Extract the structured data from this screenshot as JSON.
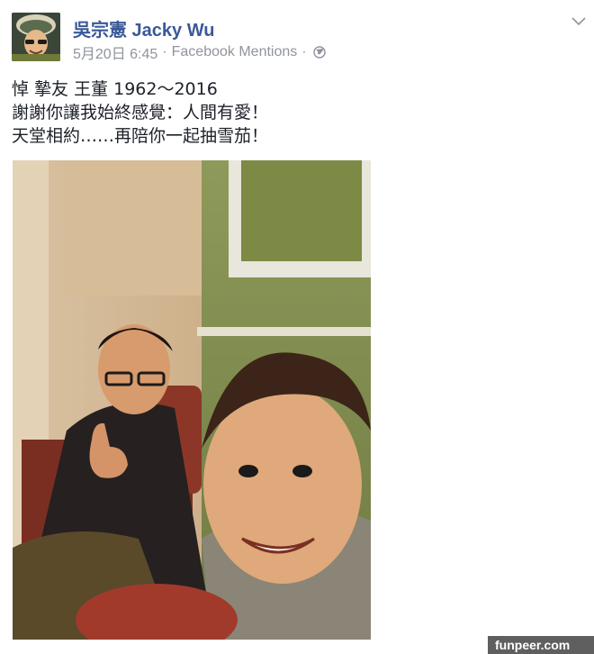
{
  "post": {
    "author_name": "吳宗憲 Jacky Wu",
    "date": "5月20日 6:45",
    "separator": "·",
    "source": "Facebook Mentions",
    "privacy_icon": "globe-icon",
    "menu_icon": "chevron-down-icon",
    "text_lines": [
      "悼 摯友 王董 1962～2016",
      "謝謝你讓我始終感覺：人間有愛！",
      "天堂相約……再陪你一起抽雪茄！"
    ]
  },
  "colors": {
    "author": "#3b5998",
    "meta": "#90949c",
    "text": "#1d2129"
  },
  "watermark": "funpeer.com"
}
